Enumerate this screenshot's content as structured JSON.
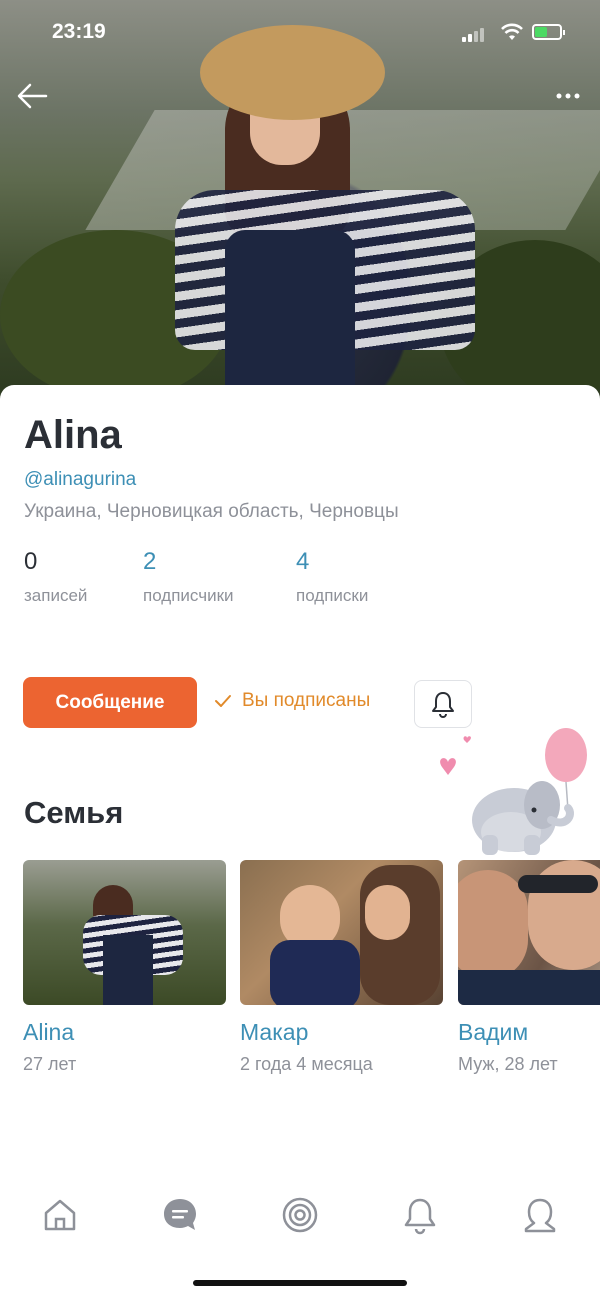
{
  "status_bar": {
    "time": "23:19"
  },
  "profile": {
    "name": "Alina",
    "handle": "@alinagurina",
    "location": "Украина, Черновицкая область, Черновцы",
    "stats": [
      {
        "value": "0",
        "label": "записей"
      },
      {
        "value": "2",
        "label": "подписчики"
      },
      {
        "value": "4",
        "label": "подписки"
      }
    ]
  },
  "actions": {
    "message_label": "Сообщение",
    "subscribed_label": "Вы подписаны"
  },
  "family": {
    "title": "Семья",
    "members": [
      {
        "name": "Alina",
        "info": "27 лет"
      },
      {
        "name": "Макар",
        "info": "2 года 4 месяца"
      },
      {
        "name": "Вадим",
        "info": "Муж, 28 лет"
      }
    ]
  },
  "tabbar": {
    "icons": [
      "home-icon",
      "chat-icon",
      "discover-icon",
      "notifications-icon",
      "profile-icon"
    ]
  },
  "colors": {
    "accent": "#ec6431",
    "link": "#3d8fb5",
    "subscribed": "#e18a2a",
    "battery": "#4cd964"
  }
}
